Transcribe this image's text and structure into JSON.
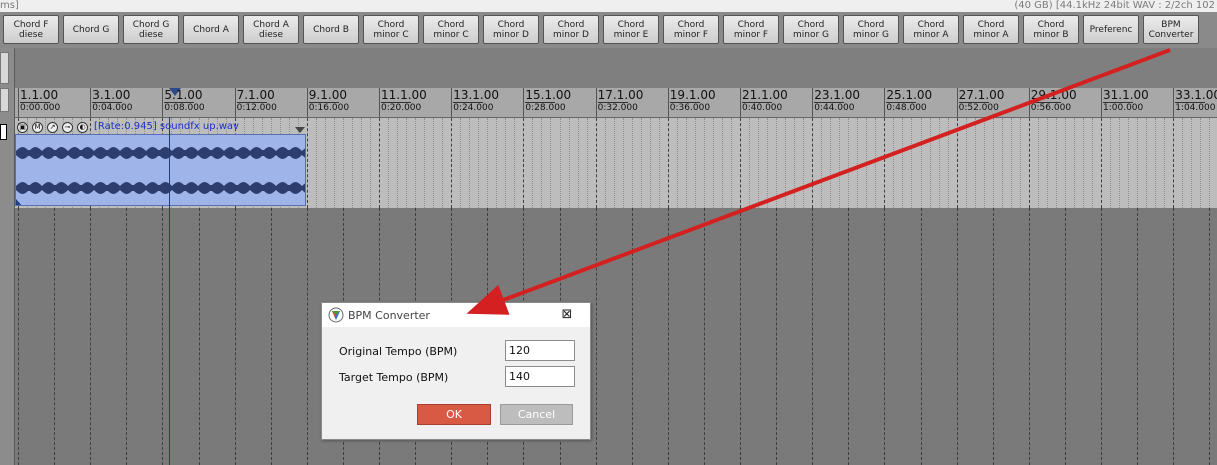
{
  "titlebar": {
    "left": "ms]",
    "right": "(40 GB) [44.1kHz 24bit WAV : 2/2ch 102"
  },
  "toolbar": {
    "buttons": [
      "Chord F\ndiese",
      "Chord G",
      "Chord G\ndiese",
      "Chord A",
      "Chord A\ndiese",
      "Chord B",
      "Chord\nminor C",
      "Chord\nminor C",
      "Chord\nminor D",
      "Chord\nminor D",
      "Chord\nminor E",
      "Chord\nminor F",
      "Chord\nminor F",
      "Chord\nminor G",
      "Chord\nminor G",
      "Chord\nminor A",
      "Chord\nminor A",
      "Chord\nminor B",
      "Preferenc",
      "BPM\nConverter"
    ]
  },
  "ruler": {
    "bars": [
      "1.1.00",
      "3.1.00",
      "5.1.00",
      "7.1.00",
      "9.1.00",
      "11.1.00",
      "13.1.00",
      "15.1.00",
      "17.1.00",
      "19.1.00",
      "21.1.00",
      "23.1.00",
      "25.1.00",
      "27.1.00",
      "29.1.00",
      "31.1.00",
      "33.1.00"
    ],
    "times": [
      "0:00.000",
      "0:04.000",
      "0:08.000",
      "0:12.000",
      "0:16.000",
      "0:20.000",
      "0:24.000",
      "0:28.000",
      "0:32.000",
      "0:36.000",
      "0:40.000",
      "0:44.000",
      "0:48.000",
      "0:52.000",
      "0:56.000",
      "1:00.000",
      "1:04.000"
    ]
  },
  "item": {
    "label": "[Rate:0.945] soundfx up.wav",
    "icons": [
      "lock-icon",
      "mute-icon",
      "fx-icon",
      "envelope-icon",
      "power-icon"
    ]
  },
  "dialog": {
    "title": "BPM Converter",
    "close": "⊠",
    "original_label": "Original Tempo (BPM)",
    "original_value": "120",
    "target_label": "Target Tempo (BPM)",
    "target_value": "140",
    "ok": "OK",
    "cancel": "Cancel"
  },
  "colors": {
    "arrow": "#d42020",
    "item_fill": "#9fb4e8",
    "ok_button": "#d85a45"
  }
}
